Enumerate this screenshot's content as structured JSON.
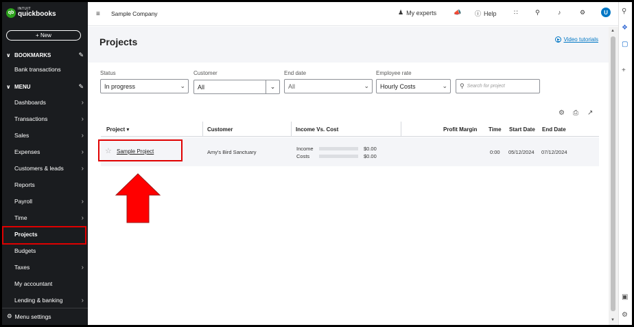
{
  "app": {
    "brand_small": "INTUIT",
    "brand": "quickbooks",
    "brand_badge": "qb",
    "company": "Sample Company"
  },
  "sidebar": {
    "new_label": "+ New",
    "bookmarks_label": "BOOKMARKS",
    "bookmark_items": [
      "Bank transactions"
    ],
    "menu_label": "MENU",
    "items": [
      {
        "label": "Dashboards",
        "arrow": true
      },
      {
        "label": "Transactions",
        "arrow": true
      },
      {
        "label": "Sales",
        "arrow": true
      },
      {
        "label": "Expenses",
        "arrow": true
      },
      {
        "label": "Customers & leads",
        "arrow": true
      },
      {
        "label": "Reports",
        "arrow": false
      },
      {
        "label": "Payroll",
        "arrow": true
      },
      {
        "label": "Time",
        "arrow": true
      },
      {
        "label": "Projects",
        "arrow": false,
        "active": true
      },
      {
        "label": "Budgets",
        "arrow": false
      },
      {
        "label": "Taxes",
        "arrow": true
      },
      {
        "label": "My accountant",
        "arrow": false
      },
      {
        "label": "Lending & banking",
        "arrow": true
      }
    ],
    "menu_settings": "Menu settings"
  },
  "topbar": {
    "my_experts": "My experts",
    "help": "Help",
    "avatar": "U"
  },
  "page": {
    "title": "Projects",
    "video_tutorials": "Video tutorials"
  },
  "filters": {
    "status_label": "Status",
    "status_value": "In progress",
    "customer_label": "Customer",
    "customer_value": "All",
    "end_date_label": "End date",
    "end_date_value": "All",
    "employee_rate_label": "Employee rate",
    "employee_rate_value": "Hourly Costs",
    "search_placeholder": "Search for project"
  },
  "table": {
    "headers": {
      "project": "Project ▾",
      "customer": "Customer",
      "income_vs_cost": "Income Vs. Cost",
      "profit_margin": "Profit Margin",
      "time": "Time",
      "start_date": "Start Date",
      "end_date": "End Date"
    },
    "rows": [
      {
        "project": "Sample Project",
        "customer": "Amy's Bird Sanctuary",
        "income_label": "Income",
        "income_value": "$0.00",
        "costs_label": "Costs",
        "costs_value": "$0.00",
        "time": "0:00",
        "start_date": "05/12/2024",
        "end_date": "07/12/2024"
      }
    ]
  },
  "colors": {
    "sidebar_bg": "#1a1c1f",
    "accent": "#0077c5",
    "brand_green": "#2ca01c",
    "highlight": "#e00000"
  }
}
